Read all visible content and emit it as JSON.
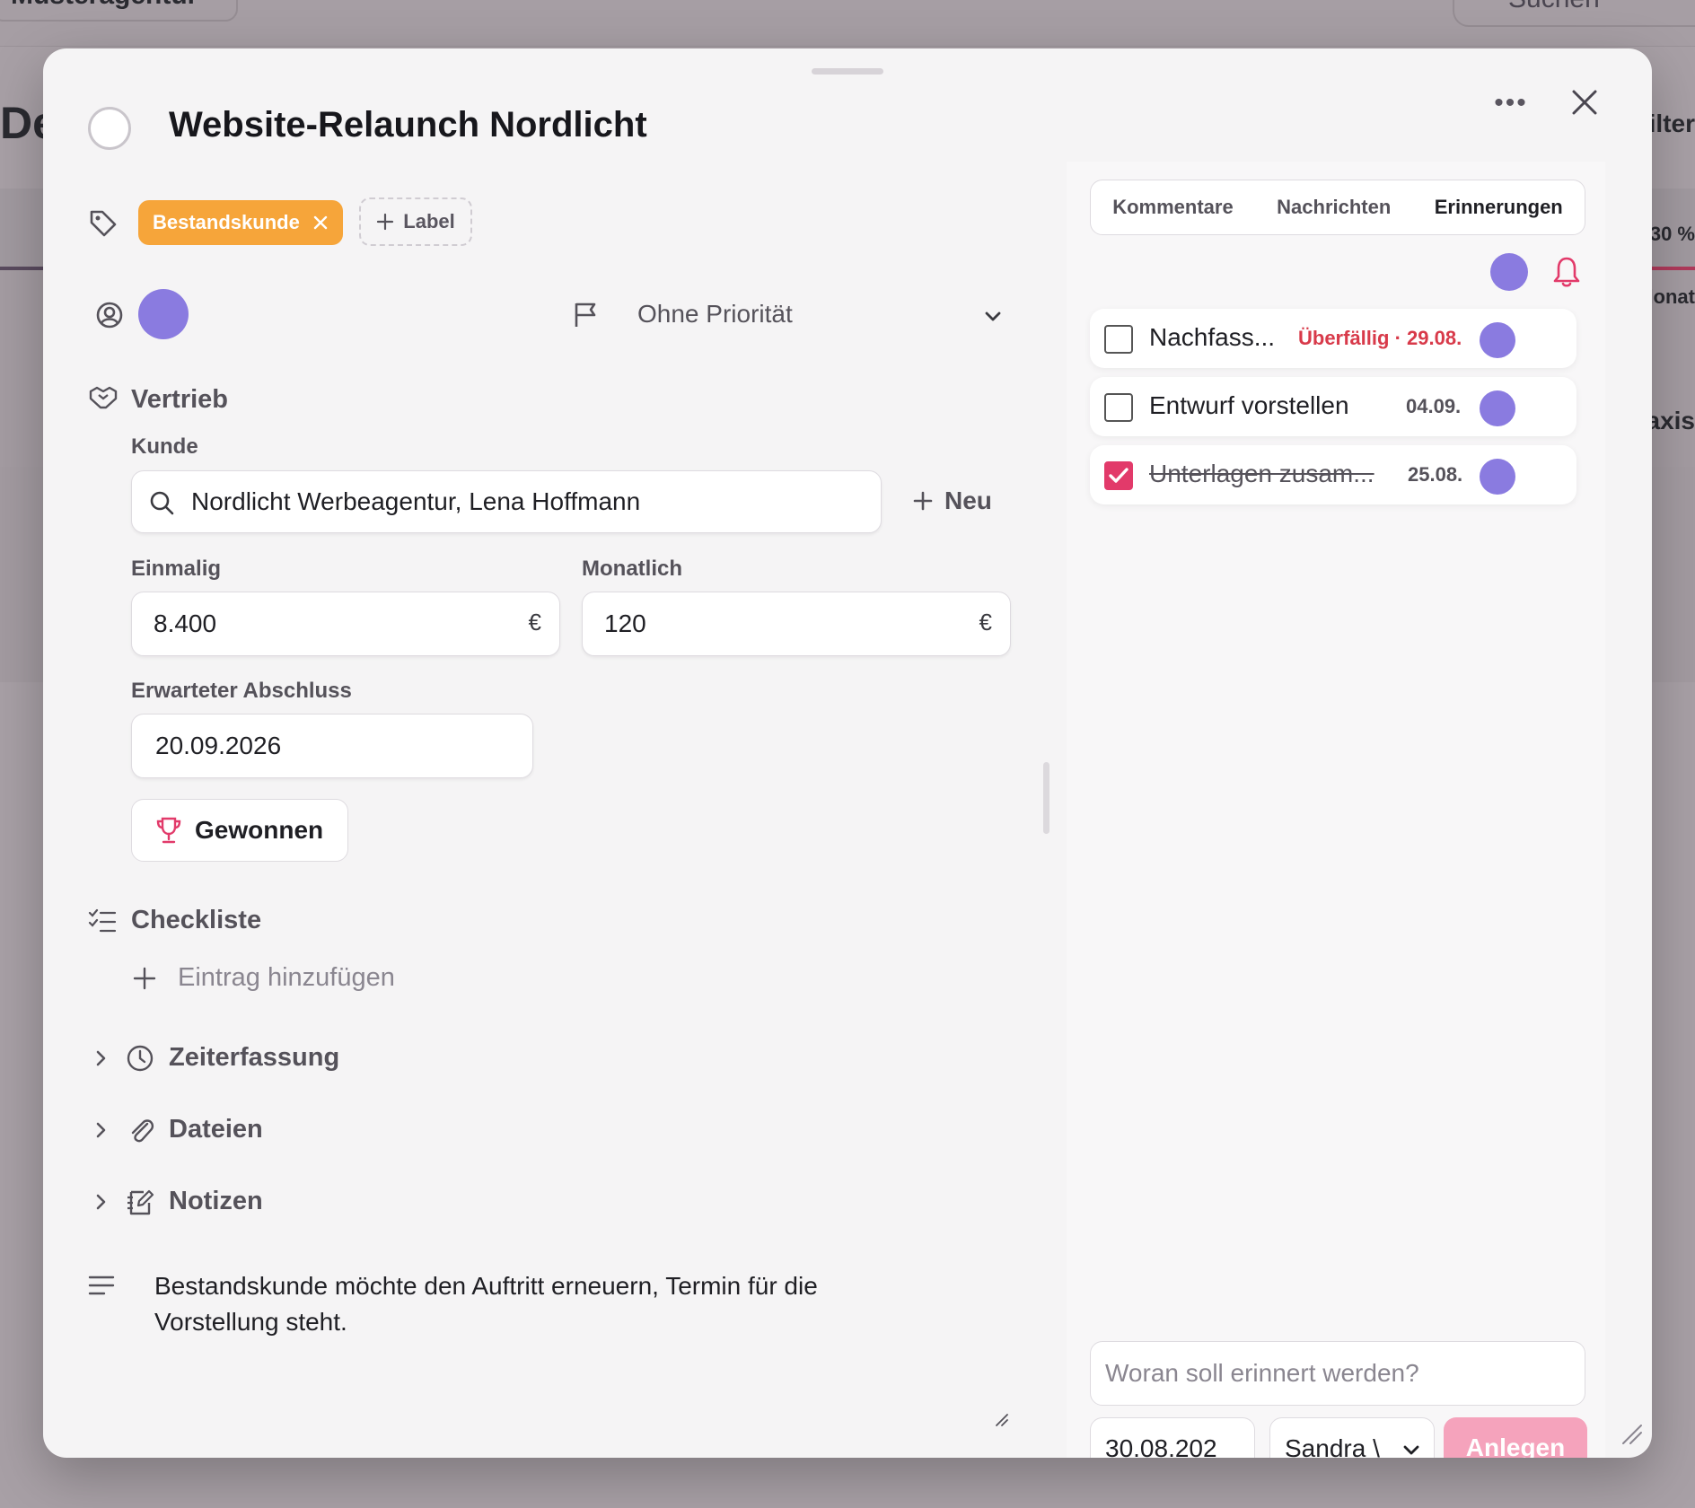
{
  "background": {
    "workspace": "Musteragentur",
    "search_placeholder": "Suchen",
    "heading_partial": "De",
    "right_text_1": "ilter",
    "right_text_2": "30 %",
    "right_text_3": "lonat",
    "right_text_4": "axis"
  },
  "task": {
    "title": "Website-Relaunch Nordlicht",
    "more_label": "•••",
    "labels": [
      {
        "text": "Bestandskunde",
        "color": "#f6a53a"
      }
    ],
    "add_label": "Label",
    "priority": "Ohne Priorität"
  },
  "sales": {
    "section_title": "Vertrieb",
    "customer_label": "Kunde",
    "customer_value": "Nordlicht Werbeagentur, Lena Hoffmann",
    "new_button": "Neu",
    "once_label": "Einmalig",
    "once_value": "8.400",
    "monthly_label": "Monatlich",
    "monthly_value": "120",
    "currency": "€",
    "close_date_label": "Erwarteter Abschluss",
    "close_date_value": "20.09.2026",
    "won_button": "Gewonnen"
  },
  "checklist": {
    "title": "Checkliste",
    "add_entry": "Eintrag hinzufügen"
  },
  "sections": [
    {
      "label": "Zeiterfassung",
      "icon": "clock-icon"
    },
    {
      "label": "Dateien",
      "icon": "paperclip-icon"
    },
    {
      "label": "Notizen",
      "icon": "notes-icon"
    }
  ],
  "description": "Bestandskunde möchte den Auftritt erneuern, Termin für die Vorstellung steht.",
  "tabs": [
    {
      "label": "Kommentare",
      "active": false
    },
    {
      "label": "Nachrichten",
      "active": false
    },
    {
      "label": "Erinnerungen",
      "active": true
    }
  ],
  "reminders": [
    {
      "text": "Nachfass...",
      "date": "Überfällig · 29.08.",
      "overdue": true,
      "done": false
    },
    {
      "text": "Entwurf vorstellen",
      "date": "04.09.",
      "overdue": false,
      "done": false
    },
    {
      "text": "Unterlagen zusam...",
      "date": "25.08.",
      "overdue": false,
      "done": true
    }
  ],
  "new_reminder": {
    "placeholder": "Woran soll erinnert werden?",
    "date_value": "30.08.202",
    "assignee_value": "Sandra \\",
    "submit_label": "Anlegen"
  },
  "colors": {
    "accent_purple": "#8a7be0",
    "label_orange": "#f6a53a",
    "overdue_red": "#d83a4a",
    "checkbox_pink": "#e23a6a",
    "bell_pink": "#e23a6a",
    "trophy_pink": "#e23a6a"
  }
}
